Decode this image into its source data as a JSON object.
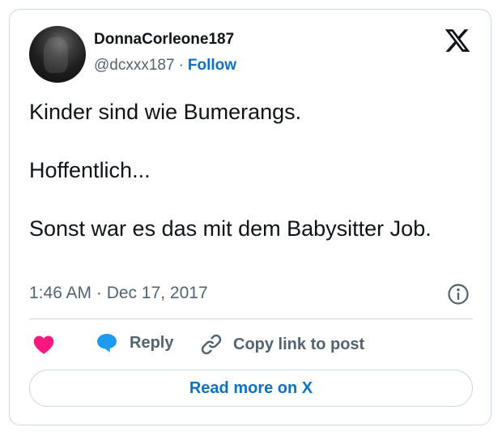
{
  "author": {
    "display_name": "DonnaCorleone187",
    "handle": "@dcxxx187",
    "separator": "·",
    "follow_label": "Follow"
  },
  "tweet": {
    "line1": "Kinder sind wie Bumerangs.",
    "line2": "Hoffentlich...",
    "line3": "Sonst war es das mit dem Babysitter Job."
  },
  "meta": {
    "timestamp": "1:46 AM · Dec 17, 2017"
  },
  "actions": {
    "reply_label": "Reply",
    "copy_label": "Copy link to post"
  },
  "cta": {
    "read_more_label": "Read more on X"
  },
  "colors": {
    "accent": "#0f71c4",
    "like": "#f91880",
    "reply_icon": "#1d9bf0",
    "text": "#0f1419",
    "muted": "#536471",
    "border": "#cfd9de"
  },
  "icons": {
    "logo": "x-logo-icon",
    "info": "info-icon",
    "like": "heart-icon",
    "reply": "speech-bubble-icon",
    "copy": "link-icon"
  }
}
